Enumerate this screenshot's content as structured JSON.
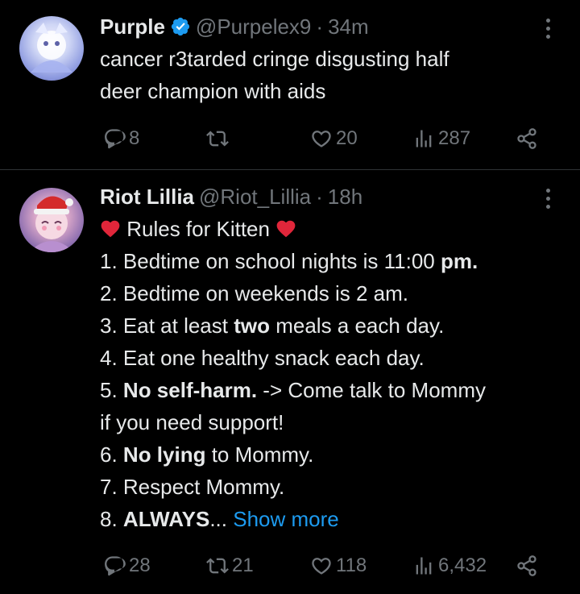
{
  "tweets": [
    {
      "name": "Purple",
      "verified": true,
      "handle": "@Purpelex9",
      "separator": "·",
      "time": "34m",
      "lines": [
        "cancer r3tarded cringe disgusting half",
        "deer champion with aids"
      ],
      "actions": {
        "replies": "8",
        "retweets": "",
        "likes": "20",
        "views": "287"
      }
    },
    {
      "name": "Riot Lillia",
      "verified": false,
      "handle": "@Riot_Lillia",
      "separator": "·",
      "time": "18h",
      "title": "Rules for Kitten",
      "rules": {
        "r1a": "1. Bedtime on school nights is 11:00 ",
        "r1b": "pm.",
        "r2": "2. Bedtime on weekends is 2 am.",
        "r3a": "3. Eat at least ",
        "r3b": "two",
        "r3c": " meals a each day.",
        "r4": "4. Eat one healthy snack each day.",
        "r5a": "5. ",
        "r5b": "No self-harm.",
        "r5c": " -> Come talk to Mommy",
        "r5d": "if you need support!",
        "r6a": "6. ",
        "r6b": "No lying",
        "r6c": " to Mommy.",
        "r7": "7. Respect Mommy.",
        "r8a": "8. ",
        "r8b": "ALWAYS",
        "r8c": "... "
      },
      "show_more": "Show more",
      "actions": {
        "replies": "28",
        "retweets": "21",
        "likes": "118",
        "views": "6,432"
      }
    }
  ],
  "colors": {
    "background": "#000000",
    "text": "#e7e9ea",
    "muted": "#71767b",
    "link": "#1d9bf0",
    "divider": "#2f3336",
    "verified": "#1d9bf0",
    "heart_emoji": "#e0263a"
  },
  "icons": [
    "verified-badge-icon",
    "more-options-icon",
    "reply-icon",
    "retweet-icon",
    "like-icon",
    "views-icon",
    "share-icon",
    "red-heart-emoji"
  ]
}
